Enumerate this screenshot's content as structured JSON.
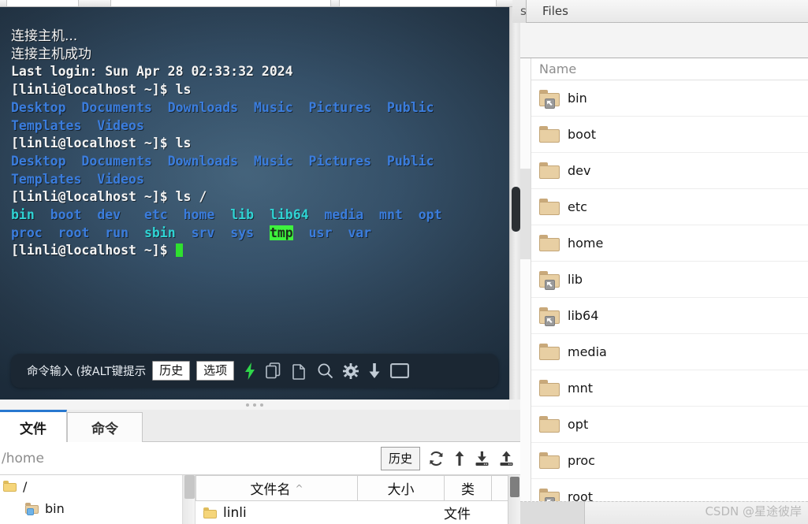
{
  "ssh_client": {
    "terminal": {
      "lines": [
        {
          "segments": [
            {
              "text": "连接主机...",
              "cls": "t-white cjk"
            }
          ]
        },
        {
          "segments": [
            {
              "text": "连接主机成功",
              "cls": "t-white cjk"
            }
          ]
        },
        {
          "segments": [
            {
              "text": "Last login: Sun Apr 28 02:33:32 2024",
              "cls": "t-white"
            }
          ]
        },
        {
          "segments": [
            {
              "text": "[linli@localhost ~]$ ls",
              "cls": "t-white"
            }
          ]
        },
        {
          "segments": [
            {
              "text": "Desktop",
              "cls": "t-blue"
            },
            {
              "text": "  ",
              "cls": "t-white"
            },
            {
              "text": "Documents",
              "cls": "t-blue"
            },
            {
              "text": "  ",
              "cls": "t-white"
            },
            {
              "text": "Downloads",
              "cls": "t-blue"
            },
            {
              "text": "  ",
              "cls": "t-white"
            },
            {
              "text": "Music",
              "cls": "t-blue"
            },
            {
              "text": "  ",
              "cls": "t-white"
            },
            {
              "text": "Pictures",
              "cls": "t-blue"
            },
            {
              "text": "  ",
              "cls": "t-white"
            },
            {
              "text": "Public",
              "cls": "t-blue"
            }
          ]
        },
        {
          "segments": [
            {
              "text": "Templates",
              "cls": "t-blue"
            },
            {
              "text": "  ",
              "cls": "t-white"
            },
            {
              "text": "Videos",
              "cls": "t-blue"
            }
          ]
        },
        {
          "segments": [
            {
              "text": "[linli@localhost ~]$ ls",
              "cls": "t-white"
            }
          ]
        },
        {
          "segments": [
            {
              "text": "Desktop",
              "cls": "t-blue"
            },
            {
              "text": "  ",
              "cls": "t-white"
            },
            {
              "text": "Documents",
              "cls": "t-blue"
            },
            {
              "text": "  ",
              "cls": "t-white"
            },
            {
              "text": "Downloads",
              "cls": "t-blue"
            },
            {
              "text": "  ",
              "cls": "t-white"
            },
            {
              "text": "Music",
              "cls": "t-blue"
            },
            {
              "text": "  ",
              "cls": "t-white"
            },
            {
              "text": "Pictures",
              "cls": "t-blue"
            },
            {
              "text": "  ",
              "cls": "t-white"
            },
            {
              "text": "Public",
              "cls": "t-blue"
            }
          ]
        },
        {
          "segments": [
            {
              "text": "Templates",
              "cls": "t-blue"
            },
            {
              "text": "  ",
              "cls": "t-white"
            },
            {
              "text": "Videos",
              "cls": "t-blue"
            }
          ]
        },
        {
          "segments": [
            {
              "text": "[linli@localhost ~]$ ls /",
              "cls": "t-white"
            }
          ]
        },
        {
          "segments": [
            {
              "text": "bin",
              "cls": "t-cyan"
            },
            {
              "text": "  ",
              "cls": "t-white"
            },
            {
              "text": "boot",
              "cls": "t-blue"
            },
            {
              "text": "  ",
              "cls": "t-white"
            },
            {
              "text": "dev",
              "cls": "t-blue"
            },
            {
              "text": "   ",
              "cls": "t-white"
            },
            {
              "text": "etc",
              "cls": "t-blue"
            },
            {
              "text": "  ",
              "cls": "t-white"
            },
            {
              "text": "home",
              "cls": "t-blue"
            },
            {
              "text": "  ",
              "cls": "t-white"
            },
            {
              "text": "lib",
              "cls": "t-cyan"
            },
            {
              "text": "  ",
              "cls": "t-white"
            },
            {
              "text": "lib64",
              "cls": "t-cyan"
            },
            {
              "text": "  ",
              "cls": "t-white"
            },
            {
              "text": "media",
              "cls": "t-blue"
            },
            {
              "text": "  ",
              "cls": "t-white"
            },
            {
              "text": "mnt",
              "cls": "t-blue"
            },
            {
              "text": "  ",
              "cls": "t-white"
            },
            {
              "text": "opt",
              "cls": "t-blue"
            }
          ]
        },
        {
          "segments": [
            {
              "text": "proc",
              "cls": "t-blue"
            },
            {
              "text": "  ",
              "cls": "t-white"
            },
            {
              "text": "root",
              "cls": "t-blue"
            },
            {
              "text": "  ",
              "cls": "t-white"
            },
            {
              "text": "run",
              "cls": "t-blue"
            },
            {
              "text": "  ",
              "cls": "t-white"
            },
            {
              "text": "sbin",
              "cls": "t-cyan"
            },
            {
              "text": "  ",
              "cls": "t-white"
            },
            {
              "text": "srv",
              "cls": "t-blue"
            },
            {
              "text": "  ",
              "cls": "t-white"
            },
            {
              "text": "sys",
              "cls": "t-blue"
            },
            {
              "text": "  ",
              "cls": "t-white"
            },
            {
              "text": "tmp",
              "cls": "t-tmp"
            },
            {
              "text": "  ",
              "cls": "t-white"
            },
            {
              "text": "usr",
              "cls": "t-blue"
            },
            {
              "text": "  ",
              "cls": "t-white"
            },
            {
              "text": "var",
              "cls": "t-blue"
            }
          ]
        },
        {
          "segments": [
            {
              "text": "[linli@localhost ~]$ ",
              "cls": "t-white"
            }
          ],
          "cursor": true
        }
      ]
    },
    "command_bar": {
      "hint": "命令输入 (按ALT键提示",
      "history_label": "历史",
      "options_label": "选项",
      "icons": [
        "lightning-icon",
        "copy-icon",
        "paste-icon",
        "search-icon",
        "gear-icon",
        "download-icon",
        "window-icon"
      ]
    },
    "tabs": [
      {
        "label": "文件",
        "active": true
      },
      {
        "label": "命令",
        "active": false
      }
    ],
    "path_bar": {
      "value": "/home",
      "history_label": "历史",
      "icons": [
        "refresh-icon",
        "up-arrow-icon",
        "download-icon",
        "upload-icon"
      ]
    },
    "tree": [
      {
        "label": "/",
        "level": 0,
        "symlink": false
      },
      {
        "label": "bin",
        "level": 1,
        "symlink": true
      }
    ],
    "file_table": {
      "columns": [
        {
          "label": "文件名",
          "sort": "asc"
        },
        {
          "label": "大小",
          "sort": null
        },
        {
          "label": "类",
          "sort": null
        }
      ],
      "rows": [
        {
          "name": "linli",
          "size": "",
          "type": "文件"
        }
      ]
    }
  },
  "files_window": {
    "title": "Files",
    "tab_sliver": "s",
    "column_header": "Name",
    "items": [
      {
        "name": "bin",
        "symlink": true
      },
      {
        "name": "boot",
        "symlink": false
      },
      {
        "name": "dev",
        "symlink": false
      },
      {
        "name": "etc",
        "symlink": false
      },
      {
        "name": "home",
        "symlink": false
      },
      {
        "name": "lib",
        "symlink": true
      },
      {
        "name": "lib64",
        "symlink": true
      },
      {
        "name": "media",
        "symlink": false
      },
      {
        "name": "mnt",
        "symlink": false
      },
      {
        "name": "opt",
        "symlink": false
      },
      {
        "name": "proc",
        "symlink": false
      },
      {
        "name": "root",
        "symlink": true
      }
    ]
  },
  "watermark": "CSDN @星途彼岸",
  "colors": {
    "terminal_bg": "#2b4257",
    "terminal_dir_blue": "#3b7ddd",
    "terminal_link_cyan": "#2fd3d3",
    "terminal_tmp_bg": "#3ef23e",
    "cursor_green": "#2fe02f",
    "lightning_green": "#2fd64a",
    "active_tab_accent": "#2878d0",
    "folder_fill": "#e8cfa3"
  }
}
